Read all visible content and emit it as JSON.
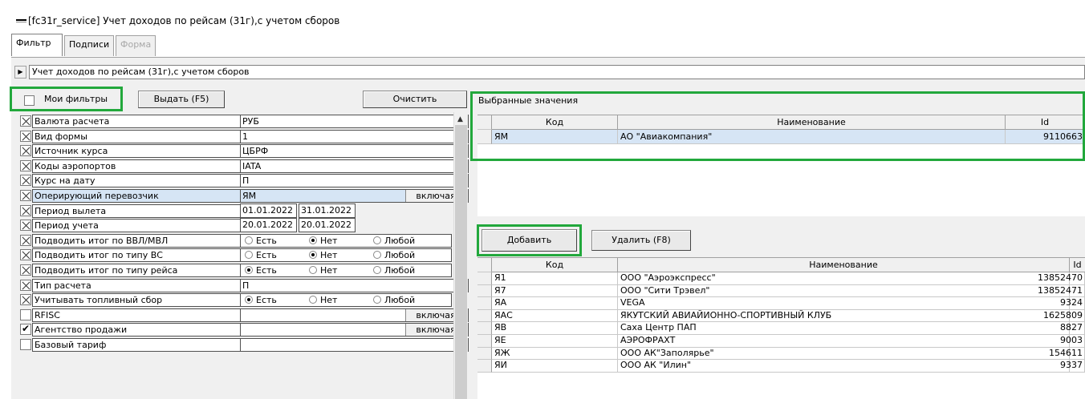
{
  "window": {
    "title": "[fc31r_service] Учет доходов по рейсам (31г),с учетом сборов"
  },
  "tabs": [
    {
      "label": "Фильтр"
    },
    {
      "label": "Подписи"
    },
    {
      "label": "Форма"
    }
  ],
  "report": {
    "name": "Учет доходов по рейсам (31г),с учетом сборов"
  },
  "toolbar": {
    "my_filters": "Мои фильтры",
    "issue": "Выдать (F5)",
    "clear": "Очистить"
  },
  "filters": [
    {
      "label": "Валюта расчета",
      "value": "РУБ",
      "check": "x"
    },
    {
      "label": "Вид формы",
      "value": "1",
      "check": "x"
    },
    {
      "label": "Источник курса",
      "value": "ЦБРФ",
      "check": "x"
    },
    {
      "label": "Коды аэропортов",
      "value": "IATA",
      "check": "x"
    },
    {
      "label": "Курс на дату",
      "value": "П",
      "check": "x"
    },
    {
      "label": "Оперирующий перевозчик",
      "value": "ЯМ",
      "suffix": "включая",
      "check": "x"
    },
    {
      "label": "Период вылета",
      "date1": "01.01.2022",
      "date2": "31.01.2022",
      "check": "x"
    },
    {
      "label": "Период учета",
      "date1": "20.01.2022",
      "date2": "20.01.2022",
      "check": "x"
    },
    {
      "label": "Подводить итог по ВВЛ/МВЛ",
      "radio": [
        "Есть",
        "Нет",
        "Любой"
      ],
      "selected": 1,
      "check": "x"
    },
    {
      "label": "Подводить итог по типу ВС",
      "radio": [
        "Есть",
        "Нет",
        "Любой"
      ],
      "selected": 1,
      "check": "x"
    },
    {
      "label": "Подводить итог по типу рейса",
      "radio": [
        "Есть",
        "Нет",
        "Любой"
      ],
      "selected": 0,
      "check": "x"
    },
    {
      "label": "Тип расчета",
      "value": "П",
      "check": "x"
    },
    {
      "label": "Учитывать топливный сбор",
      "radio": [
        "Есть",
        "Нет",
        "Любой"
      ],
      "selected": 0,
      "check": "x"
    },
    {
      "label": "RFISC",
      "value": "",
      "suffix": "включая",
      "check": "none"
    },
    {
      "label": "Агентство продажи",
      "value": "",
      "suffix": "включая",
      "check": "check"
    },
    {
      "label": "Базовый тариф",
      "value": "",
      "check": "none"
    }
  ],
  "selected": {
    "label": "Выбранные значения",
    "columns": [
      "Код",
      "Наименование",
      "Id"
    ],
    "rows": [
      {
        "code": "ЯМ",
        "name": "АО \"Авиакомпания\"",
        "id": "9110663"
      }
    ]
  },
  "actions": {
    "add": "Добавить",
    "delete": "Удалить (F8)"
  },
  "available": {
    "columns": [
      "Код",
      "Наименование",
      "Id"
    ],
    "rows": [
      {
        "code": "Я1",
        "name": "ООО \"Аэроэкспресс\"",
        "id": "13852470"
      },
      {
        "code": "Я7",
        "name": "ООО \"Сити Трэвел\"",
        "id": "13852471"
      },
      {
        "code": "ЯА",
        "name": "VEGA",
        "id": "9324"
      },
      {
        "code": "ЯАС",
        "name": "ЯКУТСКИЙ АВИАЙИОННО-СПОРТИВНЫЙ КЛУБ",
        "id": "1625809"
      },
      {
        "code": "ЯВ",
        "name": "Саха Центр ПАП",
        "id": "8827"
      },
      {
        "code": "ЯЕ",
        "name": "АЭРОФРАХТ",
        "id": "9003"
      },
      {
        "code": "ЯЖ",
        "name": "ООО АК\"Заполярье\"",
        "id": "154611"
      },
      {
        "code": "ЯИ",
        "name": "ООО АК \"Илин\"",
        "id": "9337"
      }
    ]
  }
}
